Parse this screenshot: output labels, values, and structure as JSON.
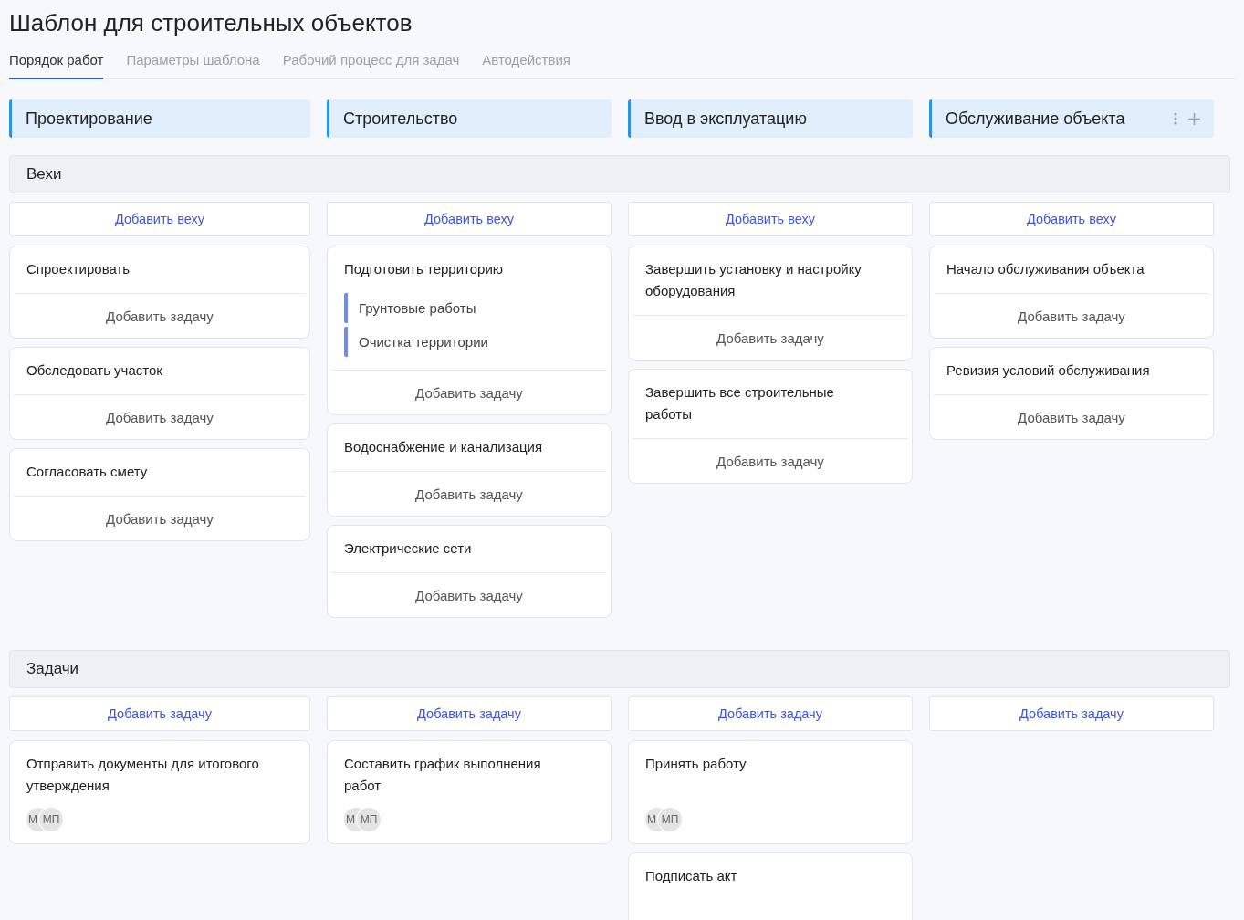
{
  "title": "Шаблон для строительных объектов",
  "tabs": [
    {
      "label": "Порядок работ",
      "selected": true
    },
    {
      "label": "Параметры шаблона",
      "selected": false
    },
    {
      "label": "Рабочий процесс для задач",
      "selected": false
    },
    {
      "label": "Автодействия",
      "selected": false
    }
  ],
  "stages": [
    {
      "name": "Проектирование",
      "actions_shown": false
    },
    {
      "name": "Строительство",
      "actions_shown": false
    },
    {
      "name": "Ввод в эксплуатацию",
      "actions_shown": false
    },
    {
      "name": "Обслуживание объекта",
      "actions_shown": true
    }
  ],
  "milestones": {
    "title": "Вехи",
    "columns": [
      {
        "add_label": "Добавить веху",
        "items": [
          {
            "title": "Спроектировать",
            "add_task_label": "Добавить задачу"
          },
          {
            "title": "Обследовать участок",
            "add_task_label": "Добавить задачу"
          },
          {
            "title": "Согласовать смету",
            "add_task_label": "Добавить задачу"
          }
        ]
      },
      {
        "add_label": "Добавить веху",
        "items": [
          {
            "title": "Подготовить территорию",
            "subtasks": [
              "Грунтовые работы",
              "Очистка территории"
            ],
            "add_task_label": "Добавить задачу"
          },
          {
            "title": "Водоснабжение и канализация",
            "add_task_label": "Добавить задачу"
          },
          {
            "title": "Электрические сети",
            "add_task_label": "Добавить задачу"
          }
        ]
      },
      {
        "add_label": "Добавить веху",
        "items": [
          {
            "title": "Завершить установку и настройку оборудования",
            "add_task_label": "Добавить задачу"
          },
          {
            "title": "Завершить все строительные работы",
            "add_task_label": "Добавить задачу"
          }
        ]
      },
      {
        "add_label": "Добавить веху",
        "items": [
          {
            "title": "Начало обслуживания объекта",
            "add_task_label": "Добавить задачу"
          },
          {
            "title": "Ревизия условий обслуживания",
            "add_task_label": "Добавить задачу"
          }
        ]
      }
    ]
  },
  "tasks": {
    "title": "Задачи",
    "columns": [
      {
        "add_label": "Добавить задачу",
        "items": [
          {
            "title": "Отправить документы для итогового утверждения",
            "assignees": [
              "М",
              "МП"
            ]
          }
        ]
      },
      {
        "add_label": "Добавить задачу",
        "items": [
          {
            "title": "Составить график выполнения работ",
            "assignees": [
              "М",
              "МП"
            ]
          }
        ]
      },
      {
        "add_label": "Добавить задачу",
        "items": [
          {
            "title": "Принять работу",
            "assignees": [
              "М",
              "МП"
            ]
          },
          {
            "title": "Подписать акт"
          }
        ]
      },
      {
        "add_label": "Добавить задачу"
      }
    ]
  }
}
